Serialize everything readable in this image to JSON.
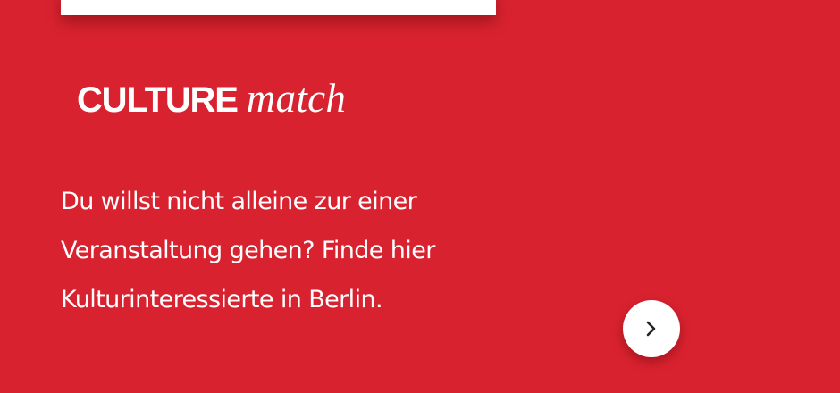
{
  "logo": {
    "part_bold": "CULTURE",
    "part_italic": "match"
  },
  "description": {
    "lines": [
      "Du willst nicht alleine zur einer",
      "Veranstaltung gehen? Finde hier",
      "Kulturinteressierte in Berlin."
    ]
  },
  "next_button": {
    "icon": "chevron-right-icon"
  },
  "colors": {
    "background": "#d9222f",
    "text": "#ffffff",
    "button_background": "#ffffff",
    "button_icon": "#222222"
  }
}
